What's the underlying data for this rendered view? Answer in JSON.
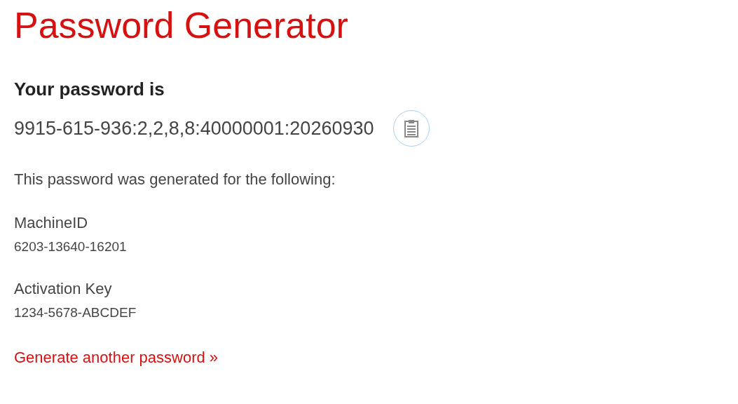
{
  "title": "Password Generator",
  "heading": "Your password is",
  "password": "9915-615-936:2,2,8,8:40000001:20260930",
  "intro": "This password was generated for the following:",
  "fields": [
    {
      "label": "MachineID",
      "value": "6203-13640-16201"
    },
    {
      "label": "Activation Key",
      "value": "1234-5678-ABCDEF"
    }
  ],
  "link": "Generate another password »"
}
